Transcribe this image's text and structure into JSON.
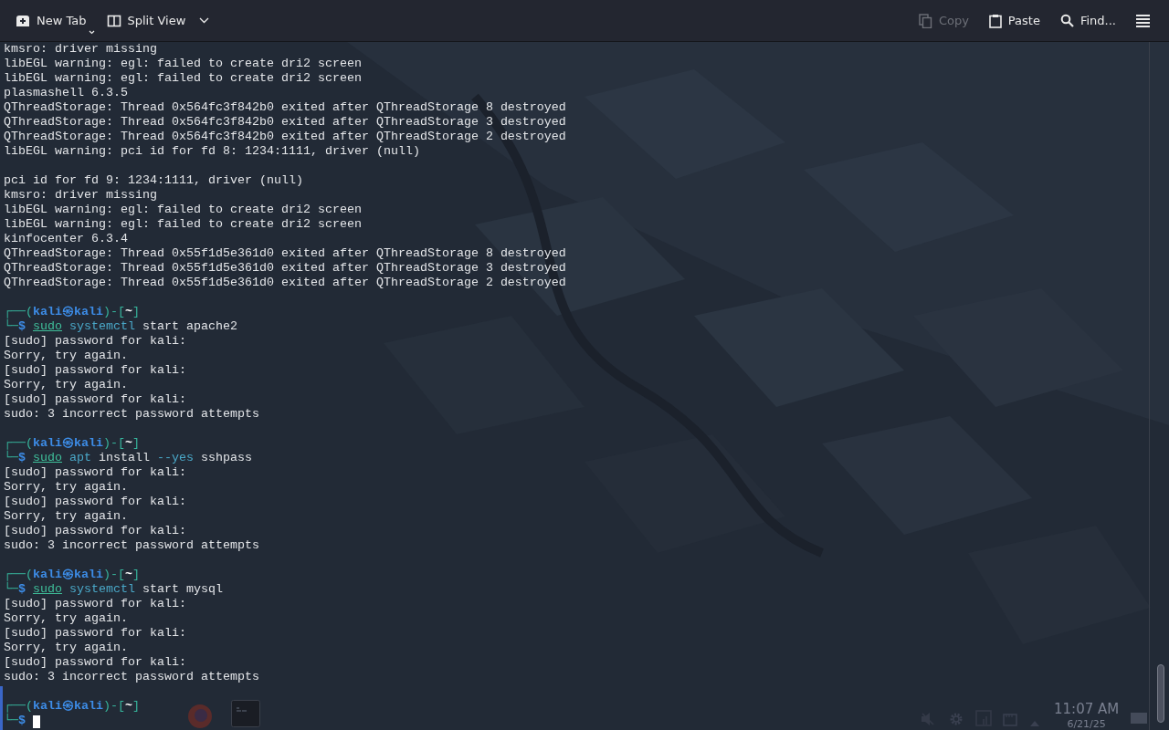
{
  "toolbar": {
    "left": [
      {
        "kind": "new-tab",
        "label": "New Tab",
        "disabled": false,
        "split_dropdown": true
      },
      {
        "kind": "split",
        "label": "Split View",
        "disabled": false,
        "dropdown": true
      }
    ],
    "right": [
      {
        "kind": "copy",
        "label": "Copy",
        "disabled": true
      },
      {
        "kind": "paste",
        "label": "Paste",
        "disabled": false
      },
      {
        "kind": "find",
        "label": "Find...",
        "disabled": false
      },
      {
        "kind": "menu",
        "disabled": false
      }
    ]
  },
  "terminal": {
    "blocks": [
      {
        "kind": "text",
        "text": "kmsro: driver missing"
      },
      {
        "kind": "text",
        "text": "libEGL warning: egl: failed to create dri2 screen"
      },
      {
        "kind": "text",
        "text": "libEGL warning: egl: failed to create dri2 screen"
      },
      {
        "kind": "text",
        "text": "plasmashell 6.3.5"
      },
      {
        "kind": "text",
        "text": "QThreadStorage: Thread 0x564fc3f842b0 exited after QThreadStorage 8 destroyed"
      },
      {
        "kind": "text",
        "text": "QThreadStorage: Thread 0x564fc3f842b0 exited after QThreadStorage 3 destroyed"
      },
      {
        "kind": "text",
        "text": "QThreadStorage: Thread 0x564fc3f842b0 exited after QThreadStorage 2 destroyed"
      },
      {
        "kind": "text",
        "text": "libEGL warning: pci id for fd 8: 1234:1111, driver (null)"
      },
      {
        "kind": "blank"
      },
      {
        "kind": "text",
        "text": "pci id for fd 9: 1234:1111, driver (null)"
      },
      {
        "kind": "text",
        "text": "kmsro: driver missing"
      },
      {
        "kind": "text",
        "text": "libEGL warning: egl: failed to create dri2 screen"
      },
      {
        "kind": "text",
        "text": "libEGL warning: egl: failed to create dri2 screen"
      },
      {
        "kind": "text",
        "text": "kinfocenter 6.3.4"
      },
      {
        "kind": "text",
        "text": "QThreadStorage: Thread 0x55f1d5e361d0 exited after QThreadStorage 8 destroyed"
      },
      {
        "kind": "text",
        "text": "QThreadStorage: Thread 0x55f1d5e361d0 exited after QThreadStorage 3 destroyed"
      },
      {
        "kind": "text",
        "text": "QThreadStorage: Thread 0x55f1d5e361d0 exited after QThreadStorage 2 destroyed"
      },
      {
        "kind": "blank"
      },
      {
        "kind": "prompt",
        "open": "┌──(",
        "user": "kali㉿kali",
        "mid": ")-[",
        "dir": "~",
        "close": "]",
        "corner": "└─",
        "sign": "$",
        "command": [
          {
            "kind": "sudo",
            "text": "sudo"
          },
          {
            "kind": "program",
            "text": "systemctl"
          },
          {
            "kind": "arg",
            "text": "start"
          },
          {
            "kind": "arg",
            "text": "apache2"
          }
        ]
      },
      {
        "kind": "text",
        "text": "[sudo] password for kali:"
      },
      {
        "kind": "text",
        "text": "Sorry, try again."
      },
      {
        "kind": "text",
        "text": "[sudo] password for kali:"
      },
      {
        "kind": "text",
        "text": "Sorry, try again."
      },
      {
        "kind": "text",
        "text": "[sudo] password for kali:"
      },
      {
        "kind": "text",
        "text": "sudo: 3 incorrect password attempts"
      },
      {
        "kind": "blank"
      },
      {
        "kind": "prompt",
        "open": "┌──(",
        "user": "kali㉿kali",
        "mid": ")-[",
        "dir": "~",
        "close": "]",
        "corner": "└─",
        "sign": "$",
        "command": [
          {
            "kind": "sudo",
            "text": "sudo"
          },
          {
            "kind": "program",
            "text": "apt"
          },
          {
            "kind": "arg",
            "text": "install"
          },
          {
            "kind": "option",
            "text": "--yes"
          },
          {
            "kind": "arg",
            "text": "sshpass"
          }
        ]
      },
      {
        "kind": "text",
        "text": "[sudo] password for kali:"
      },
      {
        "kind": "text",
        "text": "Sorry, try again."
      },
      {
        "kind": "text",
        "text": "[sudo] password for kali:"
      },
      {
        "kind": "text",
        "text": "Sorry, try again."
      },
      {
        "kind": "text",
        "text": "[sudo] password for kali:"
      },
      {
        "kind": "text",
        "text": "sudo: 3 incorrect password attempts"
      },
      {
        "kind": "blank"
      },
      {
        "kind": "prompt",
        "open": "┌──(",
        "user": "kali㉿kali",
        "mid": ")-[",
        "dir": "~",
        "close": "]",
        "corner": "└─",
        "sign": "$",
        "command": [
          {
            "kind": "sudo",
            "text": "sudo"
          },
          {
            "kind": "program",
            "text": "systemctl"
          },
          {
            "kind": "arg",
            "text": "start"
          },
          {
            "kind": "arg",
            "text": "mysql"
          }
        ]
      },
      {
        "kind": "text",
        "text": "[sudo] password for kali:"
      },
      {
        "kind": "text",
        "text": "Sorry, try again."
      },
      {
        "kind": "text",
        "text": "[sudo] password for kali:"
      },
      {
        "kind": "text",
        "text": "Sorry, try again."
      },
      {
        "kind": "text",
        "text": "[sudo] password for kali:"
      },
      {
        "kind": "text",
        "text": "sudo: 3 incorrect password attempts"
      },
      {
        "kind": "blank"
      },
      {
        "kind": "prompt",
        "open": "┌──(",
        "user": "kali㉿kali",
        "mid": ")-[",
        "dir": "~",
        "close": "]",
        "corner": "└─",
        "sign": "$",
        "cursor": true
      }
    ]
  },
  "taskbar": {
    "clock": "11:07 AM",
    "date": "6/21/25"
  }
}
